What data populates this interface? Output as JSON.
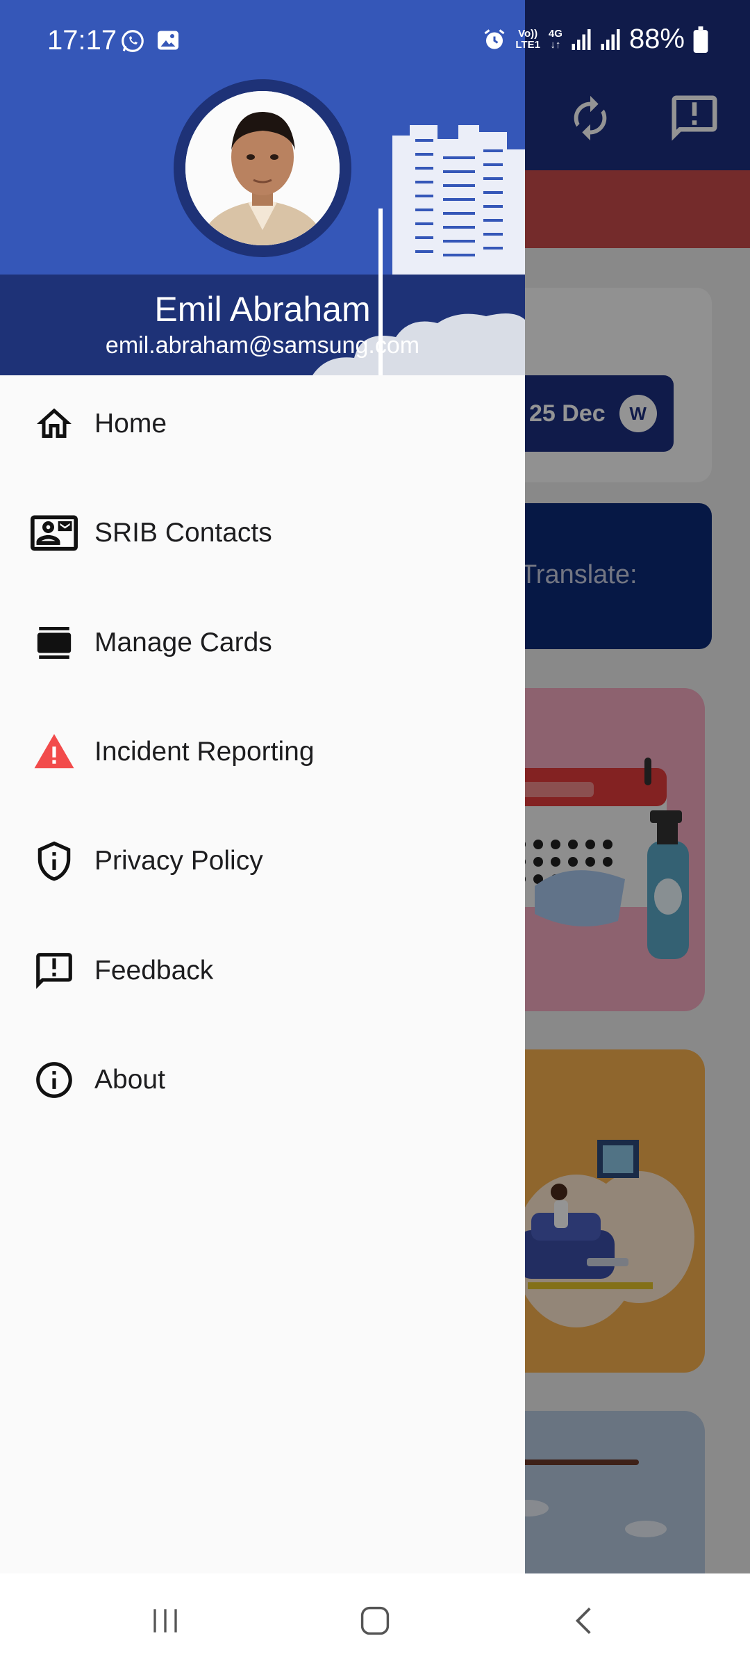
{
  "status_bar": {
    "time": "17:17",
    "battery": "88%",
    "volte": "Vo))",
    "lte": "LTE1",
    "network": "4G"
  },
  "background": {
    "date_pill": "25 Dec",
    "badge": "W",
    "translate_text": "Translate:"
  },
  "profile": {
    "name": "Emil Abraham",
    "email": "emil.abraham@samsung.com"
  },
  "menu": [
    {
      "label": "Home",
      "icon": "home-icon"
    },
    {
      "label": "SRIB Contacts",
      "icon": "contact-card-icon"
    },
    {
      "label": "Manage Cards",
      "icon": "cards-icon"
    },
    {
      "label": "Incident Reporting",
      "icon": "warning-icon"
    },
    {
      "label": "Privacy Policy",
      "icon": "shield-info-icon"
    },
    {
      "label": "Feedback",
      "icon": "feedback-icon"
    },
    {
      "label": "About",
      "icon": "info-icon"
    }
  ],
  "colors": {
    "header_blue": "#3557b8",
    "header_dark": "#1e3277",
    "warning_red": "#f24b4b"
  }
}
